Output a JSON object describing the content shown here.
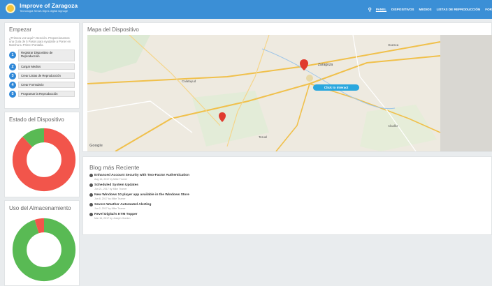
{
  "header": {
    "title": "Improve of Zaragoza",
    "subtitle": "Tecnología Smart-Signs digital signage",
    "nav": [
      "PANEL",
      "DISPOSITIVOS",
      "MEDIOS",
      "LISTAS DE REPRODUCCIÓN",
      "FOR"
    ],
    "search_icon": "search-icon",
    "colors": {
      "bar": "#3b8fd6",
      "logo": "#f3c53a"
    }
  },
  "start": {
    "title": "Empezar",
    "intro": "¿Primera vez aquí? Atención. Proporcionamos una Guía de 5 Pasos para Ayudarte a Poner en Marcha tu Primer Pantalla.",
    "steps": [
      {
        "num": "1",
        "label": "Registrar Dispositivo de Reproducción"
      },
      {
        "num": "2",
        "label": "Cargar Medios"
      },
      {
        "num": "3",
        "label": "Crear Listas de Reproducción"
      },
      {
        "num": "4",
        "label": "Crear Formulario"
      },
      {
        "num": "5",
        "label": "Programar la Reproducción"
      }
    ]
  },
  "device_status": {
    "title": "Estado del Dispositivo",
    "chart": {
      "type": "pie",
      "segments": [
        {
          "value": 88,
          "color": "#f2554b"
        },
        {
          "value": 12,
          "color": "#59ba54"
        }
      ]
    }
  },
  "storage": {
    "title": "Uso del Almacenamiento",
    "chart": {
      "type": "pie",
      "segments": [
        {
          "value": 95,
          "color": "#59ba54"
        },
        {
          "value": 5,
          "color": "#f2554b"
        }
      ]
    }
  },
  "map": {
    "title": "Mapa del Dispositivo",
    "button": "Click to interact",
    "attribution": "Google",
    "places": [
      "Zaragoza",
      "Calatayud",
      "Teruel",
      "Huesca",
      "Alcañiz"
    ]
  },
  "blog": {
    "title": "Blog más Reciente",
    "posts": [
      {
        "title": "Enhanced Account Security with Two-Factor Authentication",
        "meta": "Aug 16, 2017 by Mike Trumer"
      },
      {
        "title": "Scheduled System Updates",
        "meta": "Jun 21, 2017 by Mike Trumer"
      },
      {
        "title": "New Windows 10 player app available in the Windows Store",
        "meta": "Jun 8, 2017 by Mike Trumer"
      },
      {
        "title": "Severe Weather Automated Alerting",
        "meta": "Jun 2, 2017 by Mike Trumer"
      },
      {
        "title": "Revel Digital's KTM Topper",
        "meta": "Mar 16, 2017 by Joseph Gordon"
      }
    ]
  }
}
